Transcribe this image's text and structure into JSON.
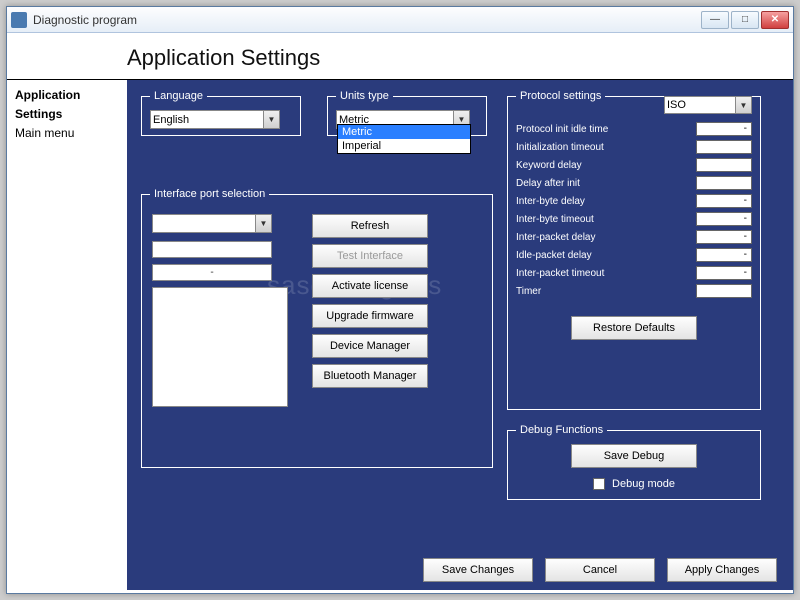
{
  "window": {
    "title": "Diagnostic program"
  },
  "page_title": "Application Settings",
  "sidebar": {
    "items": [
      "Application Settings",
      "Main menu"
    ],
    "line1": "Application",
    "line2": "Settings",
    "line3": "Main menu"
  },
  "language": {
    "legend": "Language",
    "value": "English"
  },
  "units": {
    "legend": "Units type",
    "value": "Metric",
    "options": [
      "Metric",
      "Imperial"
    ]
  },
  "iface": {
    "legend": "Interface port selection",
    "port_value": "",
    "field2": "",
    "field3": "-",
    "buttons": {
      "refresh": "Refresh",
      "test": "Test Interface",
      "activate": "Activate license",
      "upgrade": "Upgrade firmware",
      "devmgr": "Device Manager",
      "btmgr": "Bluetooth Manager"
    }
  },
  "protocol": {
    "legend": "Protocol settings",
    "selected": "ISO",
    "rows": [
      {
        "label": "Protocol init idle time",
        "val": "-"
      },
      {
        "label": "Initialization timeout",
        "val": ""
      },
      {
        "label": "Keyword delay",
        "val": ""
      },
      {
        "label": "Delay after init",
        "val": ""
      },
      {
        "label": "Inter-byte delay",
        "val": "-"
      },
      {
        "label": "Inter-byte timeout",
        "val": "-"
      },
      {
        "label": "Inter-packet delay",
        "val": "-"
      },
      {
        "label": "Idle-packet delay",
        "val": "-"
      },
      {
        "label": "Inter-packet timeout",
        "val": "-"
      },
      {
        "label": "Timer",
        "val": ""
      }
    ],
    "restore": "Restore Defaults"
  },
  "debug": {
    "legend": "Debug Functions",
    "save": "Save Debug",
    "mode_label": "Debug mode"
  },
  "footer": {
    "save": "Save Changes",
    "cancel": "Cancel",
    "apply": "Apply Changes"
  },
  "watermark": "sasomange.rs"
}
